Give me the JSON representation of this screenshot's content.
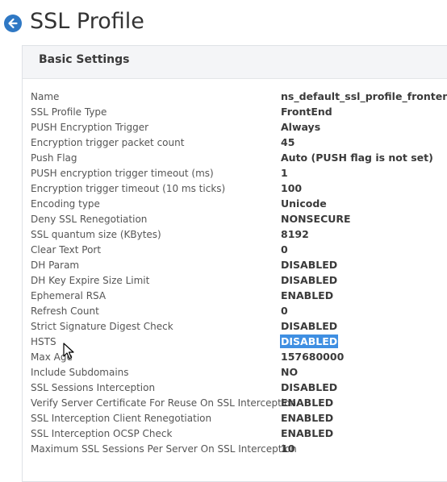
{
  "page": {
    "title": "SSL Profile"
  },
  "panel": {
    "title": "Basic Settings",
    "rows": [
      {
        "label": "Name",
        "value": "ns_default_ssl_profile_frontend"
      },
      {
        "label": "SSL Profile Type",
        "value": "FrontEnd"
      },
      {
        "label": "PUSH Encryption Trigger",
        "value": "Always"
      },
      {
        "label": "Encryption trigger packet count",
        "value": "45"
      },
      {
        "label": "Push Flag",
        "value": "Auto (PUSH flag is not set)"
      },
      {
        "label": "PUSH encryption trigger timeout (ms)",
        "value": "1"
      },
      {
        "label": "Encryption trigger timeout (10 ms ticks)",
        "value": "100"
      },
      {
        "label": "Encoding type",
        "value": "Unicode"
      },
      {
        "label": "Deny SSL Renegotiation",
        "value": "NONSECURE"
      },
      {
        "label": "SSL quantum size (KBytes)",
        "value": "8192"
      },
      {
        "label": "Clear Text Port",
        "value": "0"
      },
      {
        "label": "DH Param",
        "value": "DISABLED"
      },
      {
        "label": "DH Key Expire Size Limit",
        "value": "DISABLED"
      },
      {
        "label": "Ephemeral RSA",
        "value": "ENABLED"
      },
      {
        "label": "Refresh Count",
        "value": "0"
      },
      {
        "label": "Strict Signature Digest Check",
        "value": "DISABLED"
      },
      {
        "label": "HSTS",
        "value": "DISABLED",
        "selected": true
      },
      {
        "label": "Max Age",
        "value": "157680000"
      },
      {
        "label": "Include Subdomains",
        "value": "NO"
      },
      {
        "label": "SSL Sessions Interception",
        "value": "DISABLED"
      },
      {
        "label": "Verify Server Certificate For Reuse On SSL Interception",
        "value": "ENABLED"
      },
      {
        "label": "SSL Interception Client Renegotiation",
        "value": "ENABLED"
      },
      {
        "label": "SSL Interception OCSP Check",
        "value": "ENABLED"
      },
      {
        "label": "Maximum SSL Sessions Per Server On SSL Interception",
        "value": "10"
      }
    ]
  },
  "icons": {
    "back": "back-arrow-icon",
    "cursor": "mouse-pointer-icon"
  },
  "colors": {
    "accent": "#2f78c4",
    "selection": "#3f8fe2",
    "header_bg": "#f4f5f7"
  }
}
